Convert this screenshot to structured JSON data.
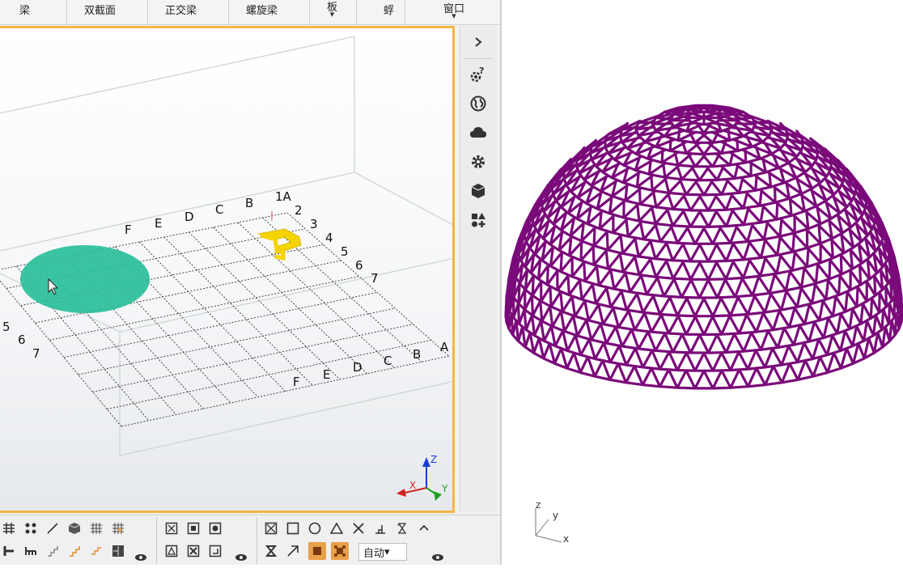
{
  "menubar": {
    "items": [
      {
        "label": "梁"
      },
      {
        "label": "双截面"
      },
      {
        "label": "正交梁"
      },
      {
        "label": "螺旋梁"
      },
      {
        "label": "板"
      },
      {
        "label": "蜉"
      },
      {
        "label": "窗口"
      }
    ]
  },
  "viewport": {
    "grid_labels_top": [
      "F",
      "E",
      "D",
      "C",
      "B",
      "A"
    ],
    "grid_labels_top_numbers": [
      "1",
      "2",
      "3",
      "4",
      "5",
      "6",
      "7"
    ],
    "grid_labels_bottom": [
      "F",
      "E",
      "D",
      "C",
      "B",
      "A"
    ],
    "grid_labels_left": [
      "5",
      "6",
      "7"
    ],
    "grid_label_overlap": "1A",
    "axis_z": "Z",
    "axis_y": "Y",
    "axis_x": "X",
    "colors": {
      "ellipse_mesh": "#2ec4a0",
      "spiral_object": "#f5d400",
      "frame_border": "#f5b547"
    }
  },
  "sidebar": {
    "icons": [
      "chevron-right-icon",
      "settings-question-icon",
      "globe-icon",
      "cloud-icon",
      "gear-icon",
      "cube-icon",
      "shapes-icon"
    ]
  },
  "toolbar": {
    "auto_label": "自动",
    "dropdown_arrow": "▾"
  },
  "right_view": {
    "dome_color": "#7a0a7a",
    "axis_z": "z",
    "axis_y": "y",
    "axis_x": "x"
  }
}
